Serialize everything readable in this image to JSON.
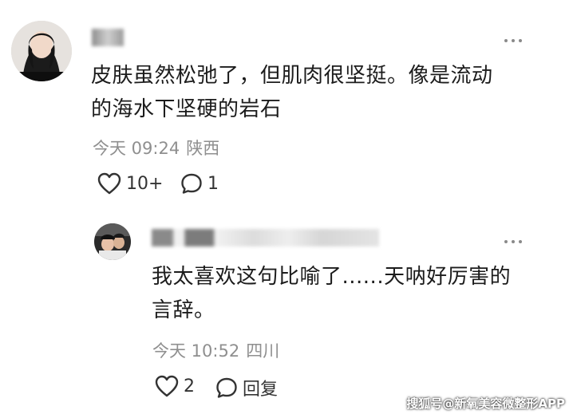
{
  "comments": [
    {
      "text": "皮肤虽然松弛了，但肌肉很坚挺。像是流动的海水下坚硬的岩石",
      "line1": "皮肤虽然松弛了，但肌肉很坚挺。像是流动",
      "line2": "的海水下坚硬的岩石",
      "time": "今天 09:24",
      "location": "陕西",
      "like_count": "10+",
      "reply_count": "1",
      "icons": {
        "like": "heart-outline-icon",
        "reply": "speech-bubble-icon",
        "more": "more-dots-icon"
      }
    }
  ],
  "reply": {
    "line1": "我太喜欢这句比喻了......天呐好厉害的",
    "line2": "言辞。",
    "time": "今天 10:52",
    "location": "四川",
    "like_count": "2",
    "reply_label": "回复",
    "icons": {
      "like": "heart-outline-icon",
      "reply": "speech-bubble-icon",
      "more": "more-dots-icon"
    }
  },
  "watermark": "搜狐号@新氧美容微整形APP"
}
